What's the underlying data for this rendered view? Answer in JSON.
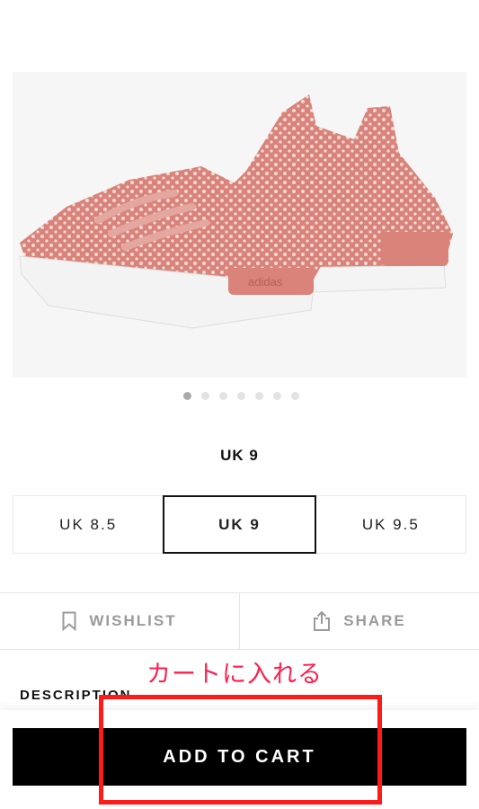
{
  "product": {
    "image_alt": "Pink knit sneakers",
    "brand_mark": "adidas",
    "gallery_count": 7,
    "gallery_active_index": 0
  },
  "size": {
    "selected_label": "UK 9",
    "options": [
      "UK 8.5",
      "UK 9",
      "UK 9.5"
    ],
    "selected_index": 1
  },
  "actions": {
    "wishlist_label": "WISHLIST",
    "share_label": "SHARE"
  },
  "annotation": {
    "text": "カートに入れる",
    "color": "#ff1f4f"
  },
  "description": {
    "heading": "DESCRIPTION"
  },
  "cart": {
    "button_label": "ADD TO CART"
  },
  "colors": {
    "shoe": "#d9837a",
    "highlight": "#ff1a1a",
    "button_bg": "#000000"
  }
}
